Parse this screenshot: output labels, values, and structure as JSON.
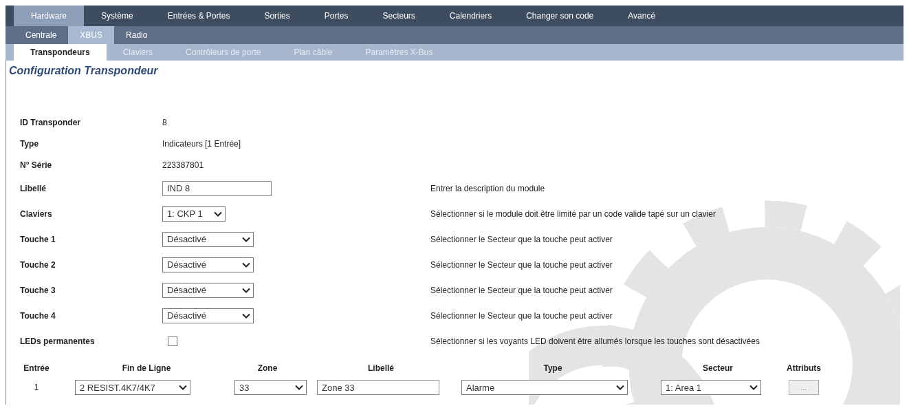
{
  "main_tabs": [
    {
      "label": "Hardware",
      "selected": true
    },
    {
      "label": "Système",
      "selected": false
    },
    {
      "label": "Entrées & Portes",
      "selected": false
    },
    {
      "label": "Sorties",
      "selected": false
    },
    {
      "label": "Portes",
      "selected": false
    },
    {
      "label": "Secteurs",
      "selected": false
    },
    {
      "label": "Calendriers",
      "selected": false
    },
    {
      "label": "Changer son code",
      "selected": false
    },
    {
      "label": "Avancé",
      "selected": false
    }
  ],
  "sub_tabs": [
    {
      "label": "Centrale",
      "selected": false
    },
    {
      "label": "XBUS",
      "selected": true
    },
    {
      "label": "Radio",
      "selected": false
    }
  ],
  "section_tabs": [
    {
      "label": "Transpondeurs",
      "selected": true
    },
    {
      "label": "Claviers",
      "selected": false
    },
    {
      "label": "Contrôleurs de porte",
      "selected": false
    },
    {
      "label": "Plan câble",
      "selected": false
    },
    {
      "label": "Paramètres X-Bus",
      "selected": false
    }
  ],
  "title": "Configuration Transpondeur",
  "fields": [
    {
      "kind": "text",
      "label": "ID Transponder",
      "value": "8"
    },
    {
      "kind": "text",
      "label": "Type",
      "value": "Indicateurs [1 Entrée]"
    },
    {
      "kind": "text",
      "label": "N° Série",
      "value": "223387801"
    },
    {
      "kind": "input",
      "label": "Libellé",
      "value": "IND 8",
      "description": "Entrer la description du module"
    },
    {
      "kind": "select",
      "label": "Claviers",
      "value": "1: CKP 1",
      "description": "Sélectionner si le module doit être limité par un code valide tapé sur un clavier"
    },
    {
      "kind": "select",
      "label": "Touche 1",
      "value": "Désactivé",
      "description": "Sélectionner le Secteur que la touche peut activer"
    },
    {
      "kind": "select",
      "label": "Touche 2",
      "value": "Désactivé",
      "description": "Sélectionner le Secteur que la touche peut activer"
    },
    {
      "kind": "select",
      "label": "Touche 3",
      "value": "Désactivé",
      "description": "Sélectionner le Secteur que la touche peut activer"
    },
    {
      "kind": "select",
      "label": "Touche 4",
      "value": "Désactivé",
      "description": "Sélectionner le Secteur que la touche peut activer"
    },
    {
      "kind": "checkbox",
      "label": "LEDs permanentes",
      "checked": false,
      "description": "Sélectionner si les voyants LED doivent être allumés lorsque les touches sont désactivées"
    }
  ],
  "inputs_table": {
    "columns": [
      "Entrée",
      "Fin de Ligne",
      "Zone",
      "Libellé",
      "Type",
      "Secteur",
      "Attributs"
    ],
    "rows": [
      {
        "cells": [
          {
            "kind": "text",
            "value": "1"
          },
          {
            "kind": "select",
            "value": "2 RESIST.4K7/4K7"
          },
          {
            "kind": "select",
            "value": "33"
          },
          {
            "kind": "input",
            "value": "Zone 33"
          },
          {
            "kind": "select",
            "value": "Alarme"
          },
          {
            "kind": "select",
            "value": "1: Area 1"
          },
          {
            "kind": "button",
            "value": "..."
          }
        ]
      }
    ]
  }
}
